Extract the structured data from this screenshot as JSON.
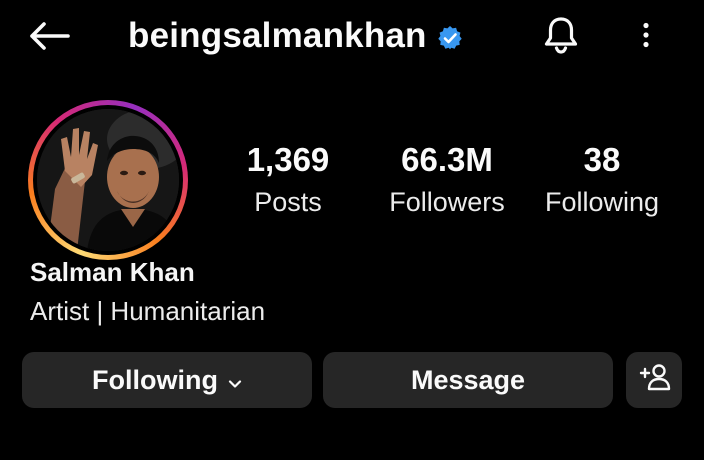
{
  "header": {
    "username": "beingsalmankhan",
    "verified": true,
    "icons": [
      "back-arrow-icon",
      "verified-badge-icon",
      "bell-icon",
      "more-vertical-icon"
    ]
  },
  "profile": {
    "display_name": "Salman Khan",
    "bio": "Artist | Humanitarian",
    "stats": [
      {
        "value": "1,369",
        "label": "Posts"
      },
      {
        "value": "66.3M",
        "label": "Followers"
      },
      {
        "value": "38",
        "label": "Following"
      }
    ]
  },
  "actions": {
    "following_label": "Following",
    "message_label": "Message",
    "add_user_icon": "add-person-icon"
  },
  "colors": {
    "background": "#000000",
    "button": "#262626",
    "verified": "#3897f0",
    "text": "#fafafa"
  }
}
